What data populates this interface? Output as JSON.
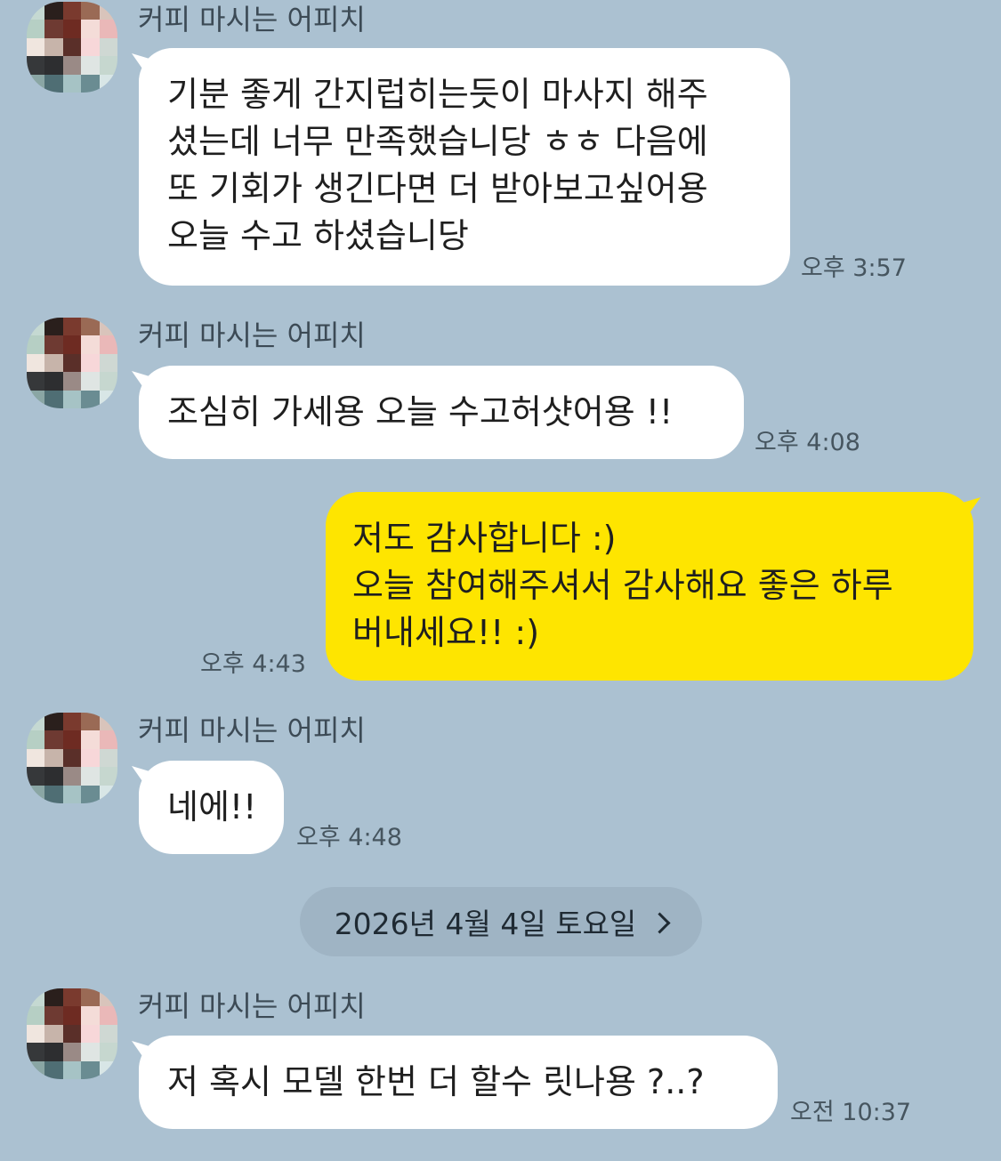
{
  "messages": [
    {
      "sender": "커피 마시는 어피치",
      "lines": [
        "기분 좋게 간지럽히는듯이 마사지 해주",
        "셨는데 너무 만족했습니당 ㅎㅎ 다음에",
        "또 기회가 생긴다면 더 받아보고싶어용",
        "오늘 수고 하셨습니당"
      ],
      "time": "오후 3:57"
    },
    {
      "sender": "커피 마시는 어피치",
      "lines": [
        "조심히 가세용 오늘 수고허샷어용 !!"
      ],
      "time": "오후 4:08"
    },
    {
      "lines": [
        "저도 감사합니다 :)",
        "오늘 참여해주셔서 감사해요 좋은 하루",
        "버내세요!! :)"
      ],
      "time": "오후 4:43"
    },
    {
      "sender": "커피 마시는 어피치",
      "lines": [
        "네에!!"
      ],
      "time": "오후 4:48"
    },
    {
      "sender": "커피 마시는 어피치",
      "lines": [
        "저 혹시 모델 한번 더 할수 릿나용 ?..?"
      ],
      "time": "오전 10:37"
    }
  ],
  "date_divider": "2026년 4월 4일 토요일",
  "colors": {
    "background": "#abc1d1",
    "incoming_bubble": "#ffffff",
    "outgoing_bubble": "#fee500",
    "date_pill": "#9fb4c4"
  },
  "icons": {
    "avatar": "pixelated-avatar",
    "date_arrow": "chevron-right-icon"
  }
}
